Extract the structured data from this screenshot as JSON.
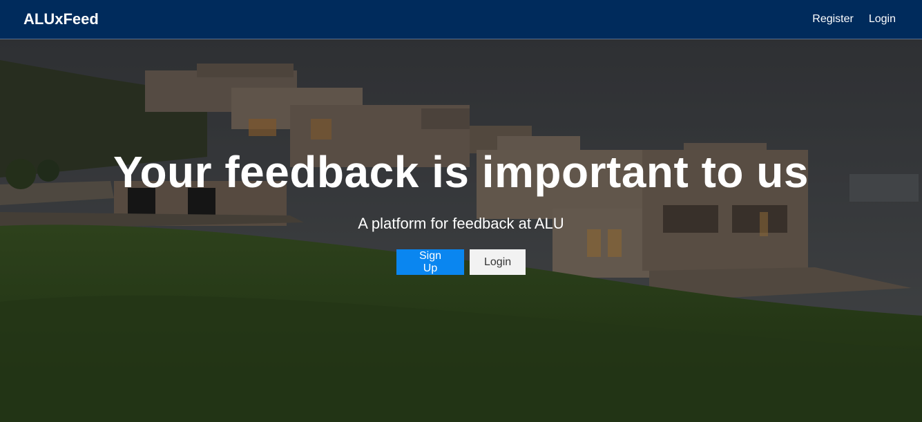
{
  "navbar": {
    "brand": "ALUxFeed",
    "links": [
      "Register",
      "Login"
    ]
  },
  "hero": {
    "title": "Your feedback is important to us",
    "subtitle": "A platform for feedback at ALU",
    "primary_button": "Sign Up",
    "secondary_button": "Login",
    "background_image": "campus-buildings-on-hillside"
  },
  "colors": {
    "navbar": "#002b5c",
    "primary": "#0a86f0",
    "secondary": "#f2f2f2"
  }
}
